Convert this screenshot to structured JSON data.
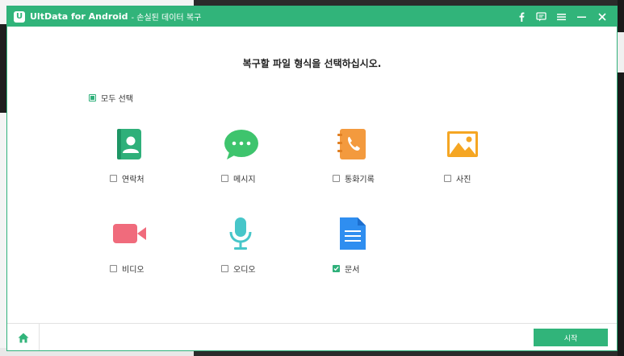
{
  "window": {
    "app_name": "UltData for Android",
    "subtitle": "- 손실된 데이터 복구",
    "logo_letter": "U",
    "title_icons": [
      "facebook-icon",
      "feedback-icon",
      "menu-icon",
      "minimize-icon",
      "close-icon"
    ]
  },
  "main": {
    "heading": "복구할 파일 형식을 선택하십시오.",
    "select_all_label": "모두 선택",
    "select_all_state": "partial",
    "types": [
      {
        "label": "연락처",
        "icon": "contacts-icon",
        "checked": false
      },
      {
        "label": "메시지",
        "icon": "messages-icon",
        "checked": false
      },
      {
        "label": "통화기록",
        "icon": "call-log-icon",
        "checked": false
      },
      {
        "label": "사진",
        "icon": "photos-icon",
        "checked": false
      },
      {
        "label": "비디오",
        "icon": "video-icon",
        "checked": false
      },
      {
        "label": "오디오",
        "icon": "audio-icon",
        "checked": false
      },
      {
        "label": "문서",
        "icon": "document-icon",
        "checked": true
      }
    ]
  },
  "footer": {
    "start_label": "시작",
    "home_icon": "home-icon"
  },
  "colors": {
    "accent": "#31b47a",
    "contacts": "#2fb07a",
    "messages": "#3ec46d",
    "call_log": "#f39a3e",
    "photos": "#f5a623",
    "video": "#f06b7c",
    "audio": "#47c6c9",
    "document": "#2f8ef0"
  }
}
